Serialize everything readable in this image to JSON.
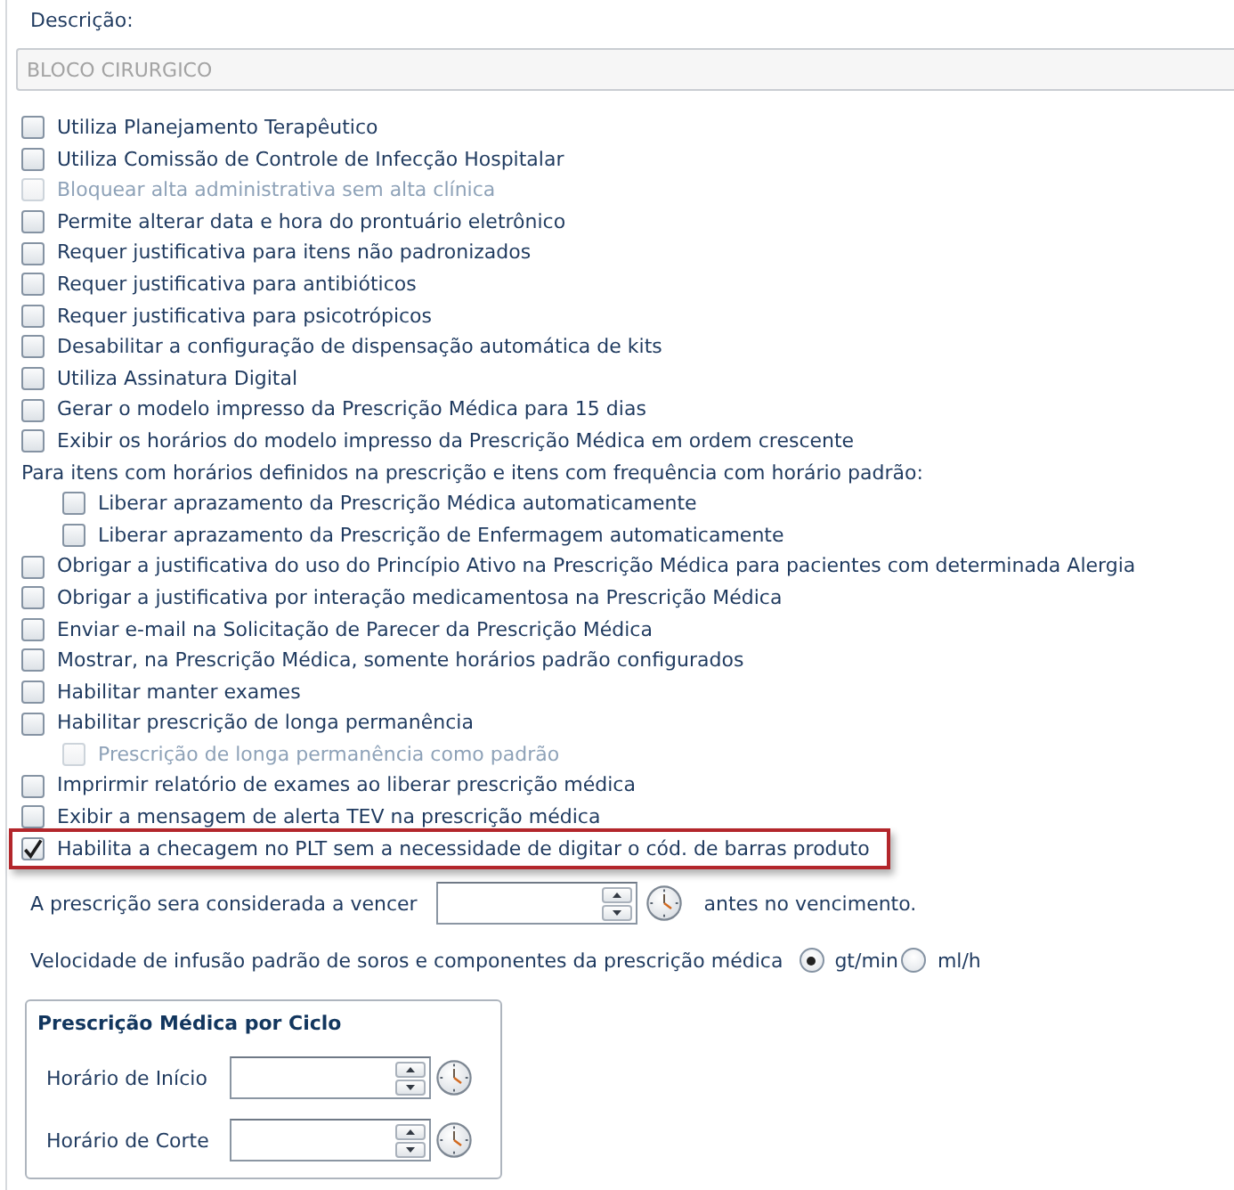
{
  "description": {
    "label": "Descrição:",
    "value": "BLOCO CIRURGICO",
    "disabled": true
  },
  "options": [
    {
      "kind": "checkbox",
      "label": "Utiliza Planejamento Terapêutico",
      "checked": false,
      "disabled": false,
      "highlighted": false
    },
    {
      "kind": "checkbox",
      "label": "Utiliza Comissão de Controle de Infecção Hospitalar",
      "checked": false,
      "disabled": false,
      "highlighted": false
    },
    {
      "kind": "checkbox",
      "label": "Bloquear alta administrativa sem alta clínica",
      "checked": false,
      "disabled": true,
      "highlighted": false
    },
    {
      "kind": "checkbox",
      "label": "Permite alterar data e hora do prontuário eletrônico",
      "checked": false,
      "disabled": false,
      "highlighted": false
    },
    {
      "kind": "checkbox",
      "label": "Requer justificativa para itens não padronizados",
      "checked": false,
      "disabled": false,
      "highlighted": false
    },
    {
      "kind": "checkbox",
      "label": "Requer justificativa para antibióticos",
      "checked": false,
      "disabled": false,
      "highlighted": false
    },
    {
      "kind": "checkbox",
      "label": "Requer justificativa para psicotrópicos",
      "checked": false,
      "disabled": false,
      "highlighted": false
    },
    {
      "kind": "checkbox",
      "label": "Desabilitar a configuração de dispensação automática de kits",
      "checked": false,
      "disabled": false,
      "highlighted": false
    },
    {
      "kind": "checkbox",
      "label": "Utiliza Assinatura Digital",
      "checked": false,
      "disabled": false,
      "highlighted": false
    },
    {
      "kind": "checkbox",
      "label": "Gerar o modelo impresso da Prescrição Médica para 15 dias",
      "checked": false,
      "disabled": false,
      "highlighted": false
    },
    {
      "kind": "checkbox",
      "label": "Exibir os horários do modelo impresso da Prescrição Médica em ordem crescente",
      "checked": false,
      "disabled": false,
      "highlighted": false
    },
    {
      "kind": "heading",
      "label": "Para itens com horários definidos na prescrição e itens com frequência com horário padrão:",
      "children": [
        {
          "kind": "checkbox",
          "label": "Liberar aprazamento da Prescrição Médica automaticamente",
          "checked": false,
          "disabled": false,
          "highlighted": false
        },
        {
          "kind": "checkbox",
          "label": "Liberar aprazamento da Prescrição de Enfermagem automaticamente",
          "checked": false,
          "disabled": false,
          "highlighted": false
        }
      ]
    },
    {
      "kind": "checkbox",
      "label": "Obrigar a justificativa do uso do Princípio Ativo na Prescrição Médica para pacientes com determinada Alergia",
      "checked": false,
      "disabled": false,
      "highlighted": false
    },
    {
      "kind": "checkbox",
      "label": "Obrigar a justificativa por interação medicamentosa na Prescrição Médica",
      "checked": false,
      "disabled": false,
      "highlighted": false
    },
    {
      "kind": "checkbox",
      "label": "Enviar e-mail na Solicitação de Parecer da Prescrição Médica",
      "checked": false,
      "disabled": false,
      "highlighted": false
    },
    {
      "kind": "checkbox",
      "label": "Mostrar, na Prescrição Médica, somente horários padrão configurados",
      "checked": false,
      "disabled": false,
      "highlighted": false
    },
    {
      "kind": "checkbox",
      "label": "Habilitar manter exames",
      "checked": false,
      "disabled": false,
      "highlighted": false
    },
    {
      "kind": "checkbox",
      "label": "Habilitar prescrição de longa permanência",
      "checked": false,
      "disabled": false,
      "highlighted": false,
      "children": [
        {
          "kind": "checkbox",
          "label": "Prescrição de longa permanência como padrão",
          "checked": false,
          "disabled": true,
          "highlighted": false
        }
      ]
    },
    {
      "kind": "checkbox",
      "label": "Imprirmir relatório de exames ao liberar prescrição médica",
      "checked": false,
      "disabled": false,
      "highlighted": false
    },
    {
      "kind": "checkbox",
      "label": "Exibir a mensagem de alerta TEV na prescrição médica",
      "checked": false,
      "disabled": false,
      "highlighted": false
    },
    {
      "kind": "checkbox",
      "label": "Habilita a checagem no PLT sem a necessidade de digitar o cód. de barras produto",
      "checked": true,
      "disabled": false,
      "highlighted": true
    }
  ],
  "expiry": {
    "label": "A prescrição sera considerada a vencer",
    "suffix": "antes no vencimento."
  },
  "infusion": {
    "label": "Velocidade de infusão padrão de soros e componentes da prescrição médica",
    "options": [
      {
        "label": "gt/min",
        "selected": true
      },
      {
        "label": "ml/h",
        "selected": false
      }
    ]
  },
  "cycle_panel": {
    "title": "Prescrição Médica por Ciclo",
    "fields": [
      {
        "label": "Horário de Início"
      },
      {
        "label": "Horário de Corte"
      }
    ]
  }
}
